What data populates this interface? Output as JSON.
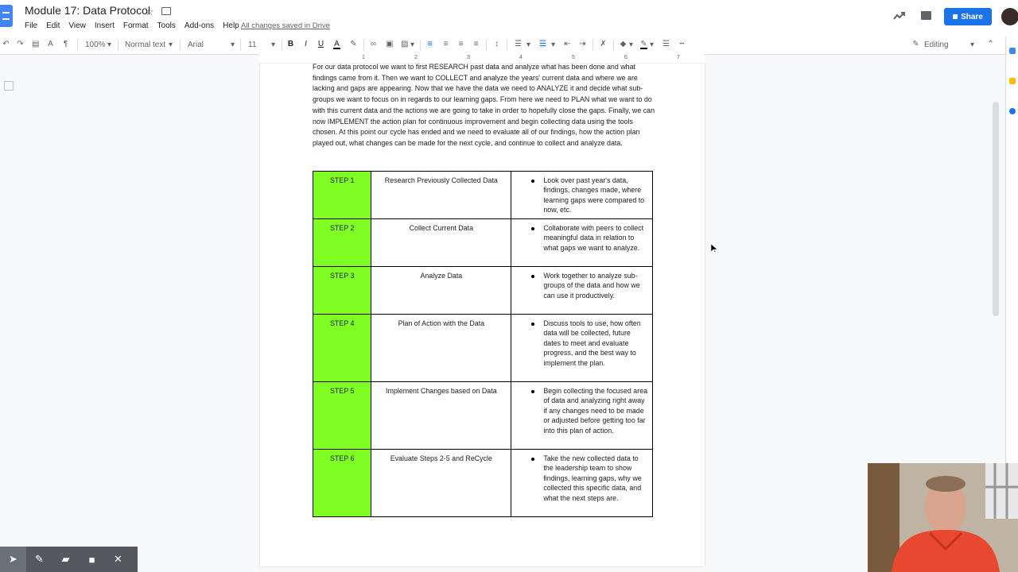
{
  "app": {
    "title": "Module 17: Data Protocol",
    "menu": [
      "File",
      "Edit",
      "View",
      "Insert",
      "Format",
      "Tools",
      "Add-ons",
      "Help"
    ],
    "save_status": "All changes saved in Drive",
    "share_label": "Share",
    "brand_color": "#4285f4",
    "accent_color": "#1a73e8"
  },
  "toolbar": {
    "zoom": "100%",
    "style": "Normal text",
    "font": "Arial",
    "size": "11",
    "mode": "Editing",
    "icons": [
      "undo-icon",
      "redo-icon",
      "print-icon",
      "spellcheck-icon",
      "paint-format-icon",
      "bold-icon",
      "italic-icon",
      "underline-icon",
      "text-color-icon",
      "highlight-icon",
      "link-icon",
      "comment-icon",
      "image-icon",
      "align-left-icon",
      "align-center-icon",
      "align-right-icon",
      "justify-icon",
      "line-spacing-icon",
      "numbered-list-icon",
      "bulleted-list-icon",
      "decrease-indent-icon",
      "increase-indent-icon",
      "clear-format-icon",
      "fill-color-icon",
      "border-color-icon",
      "border-width-icon",
      "border-dash-icon",
      "pencil-icon",
      "collapse-icon"
    ]
  },
  "ruler": {
    "numbers": [
      "1",
      "2",
      "3",
      "4",
      "5",
      "6",
      "7"
    ]
  },
  "document": {
    "intro_paragraph": "For our data protocol we want to first RESEARCH past data and analyze what has been done and what findings came from it.  Then we want to COLLECT and analyze the years' current data and where we are lacking and gaps are appearing.  Now that we have the data we need to ANALYZE it and decide what sub-groups we want to focus on in regards to our learning gaps.  From here we need to PLAN what we want to do with this current data and the actions we are going to take in order to hopefully close the gaps.  Finally, we can now IMPLEMENT the action plan for continuous improvement and begin collecting data using the tools chosen.  At this point our cycle has ended and we need to evaluate all of our findings, how the action plan played out, what changes can be made for the next cycle, and continue to collect and analyze data.",
    "step_color": "#7fff24",
    "steps": [
      {
        "step": "STEP 1",
        "title": "Research Previously Collected Data",
        "detail": "Look over past year's data, findings, changes made, where learning gaps were compared to now, etc."
      },
      {
        "step": "STEP 2",
        "title": "Collect Current Data",
        "detail": "Collaborate with peers to collect meaningful data in relation to what gaps we want to analyze."
      },
      {
        "step": "STEP 3",
        "title": "Analyze Data",
        "detail": "Work together to analyze sub-groups of the data and how we can use it productively."
      },
      {
        "step": "STEP 4",
        "title": "Plan of Action with the Data",
        "detail": "Discuss tools to use, how often data will be collected, future dates to meet and evaluate progress, and the best way to implement the plan."
      },
      {
        "step": "STEP 5",
        "title": "Implement Changes based on Data",
        "detail": "Begin collecting the focused area of data and analyzing right away if any changes need to be made or adjusted before getting too far into this plan of action."
      },
      {
        "step": "STEP 6",
        "title": "Evaluate Steps 2-5 and ReCycle",
        "detail": "Take the new collected data to the leadership team to show findings, learning gaps, why we collected this specific data, and what the next steps are."
      }
    ]
  },
  "annotation_bar": {
    "tools": [
      "pointer-icon",
      "pen-icon",
      "highlighter-icon",
      "camera-icon",
      "close-icon"
    ]
  }
}
